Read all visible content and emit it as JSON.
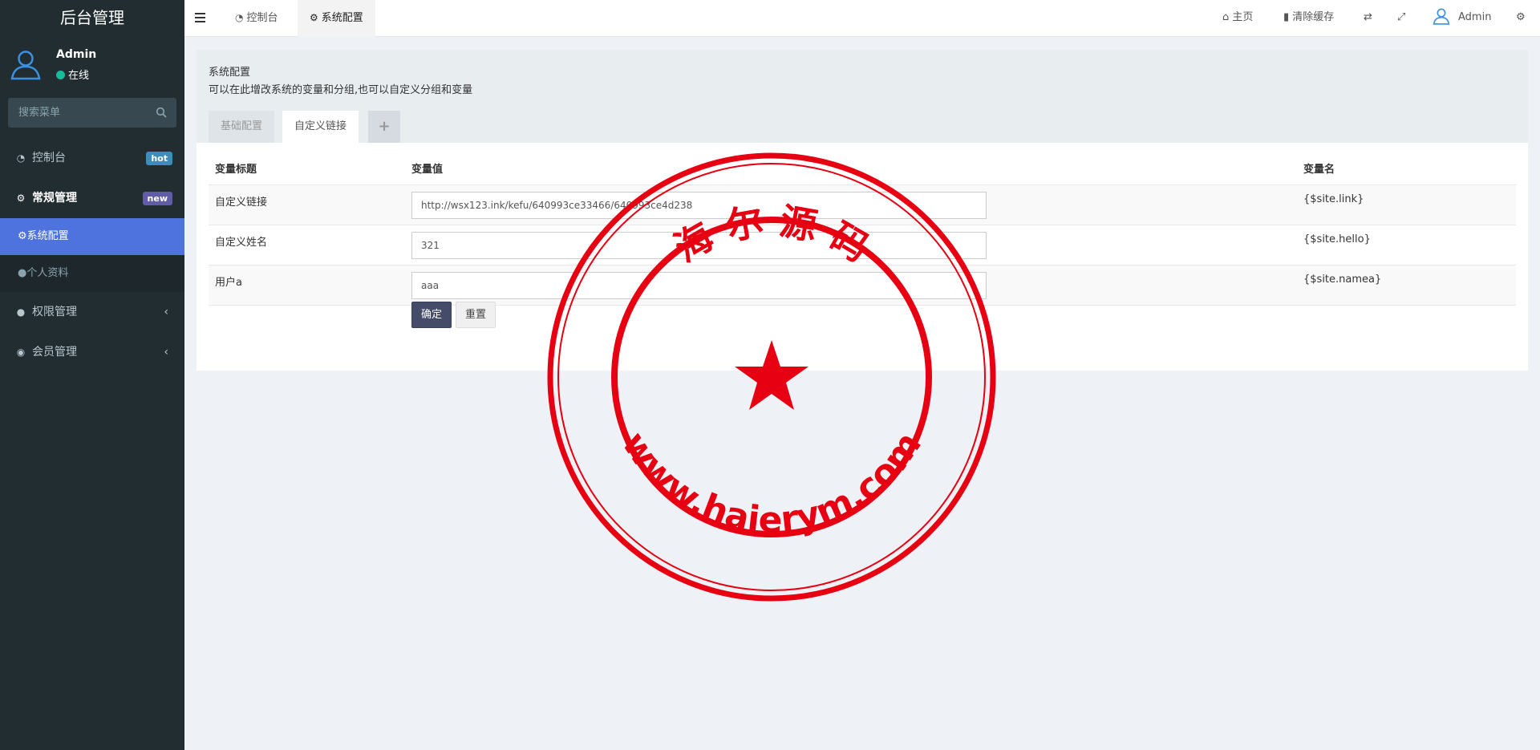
{
  "sidebar": {
    "logo": "后台管理",
    "user": {
      "name": "Admin",
      "status": "在线"
    },
    "search_placeholder": "搜索菜单",
    "menu": [
      {
        "label": "控制台",
        "badge": "hot",
        "icon": "dashboard-icon"
      },
      {
        "label": "常规管理",
        "badge": "new",
        "icon": "cogs-icon"
      },
      {
        "label": "系统配置",
        "icon": "gear-icon"
      },
      {
        "label": "个人资料",
        "icon": "user-icon"
      },
      {
        "label": "权限管理",
        "icon": "group-icon"
      },
      {
        "label": "会员管理",
        "icon": "user-circle-icon"
      }
    ]
  },
  "header": {
    "tabs": [
      {
        "label": "控制台",
        "icon": "dashboard-icon"
      },
      {
        "label": "系统配置",
        "icon": "gear-icon"
      }
    ],
    "right": {
      "home": "主页",
      "clear_cache": "清除缓存",
      "admin": "Admin"
    }
  },
  "main": {
    "title": "系统配置",
    "description": "可以在此增改系统的变量和分组,也可以自定义分组和变量",
    "tabs": [
      "基础配置",
      "自定义链接",
      "+"
    ],
    "table": {
      "headers": [
        "变量标题",
        "变量值",
        "变量名"
      ],
      "rows": [
        {
          "title": "自定义链接",
          "value": "http://wsx123.ink/kefu/640993ce33466/640993ce4d238",
          "name": "{$site.link}"
        },
        {
          "title": "自定义姓名",
          "value": "321",
          "name": "{$site.hello}"
        },
        {
          "title": "用户a",
          "value": "aaa",
          "name": "{$site.namea}"
        }
      ]
    },
    "buttons": {
      "ok": "确定",
      "reset": "重置"
    }
  },
  "watermark": {
    "top_text": "海 尔 源 码",
    "bottom_text": "www.haierym.com"
  },
  "colors": {
    "sidebar_bg": "#222d32",
    "active": "#4e73df",
    "stamp": "#e60012",
    "badge_hot": "#3c8dbc",
    "badge_new": "#605ca8",
    "primary_button": "#444c69"
  }
}
